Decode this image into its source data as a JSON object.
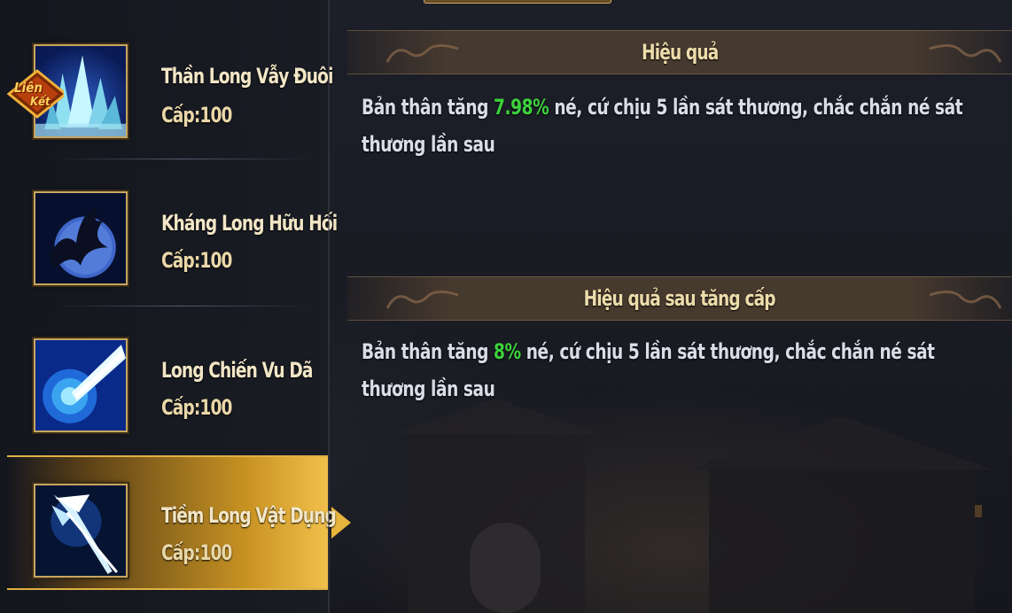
{
  "skills": [
    {
      "name": "Thần Long Vẫy Đuôi",
      "level": "Cấp:100",
      "icon": "ice-crystal-icon",
      "badge_line1": "Liên",
      "badge_line2": "Kết"
    },
    {
      "name": "Kháng Long Hữu Hối",
      "level": "Cấp:100",
      "icon": "dragon-moon-icon"
    },
    {
      "name": "Long Chiến Vu Dã",
      "level": "Cấp:100",
      "icon": "energy-beam-icon"
    },
    {
      "name": "Tiềm Long Vật Dụng",
      "level": "Cấp:100",
      "icon": "spear-icon",
      "selected": true
    }
  ],
  "effect": {
    "title": "Hiệu quả",
    "text_before": "Bản thân tăng ",
    "value": "7.98%",
    "text_after": " né, cứ chịu 5 lần sát thương, chắc chắn né sát thương lần sau"
  },
  "upgrade_effect": {
    "title": "Hiệu quả sau tăng cấp",
    "text_before": "Bản thân tăng ",
    "value": "8%",
    "text_after": " né, cứ chịu 5 lần sát thương, chắc chắn né sát thương lần sau"
  },
  "colors": {
    "highlight": "#3cd13c",
    "gold": "#e0b144",
    "text": "#d9dde8"
  }
}
